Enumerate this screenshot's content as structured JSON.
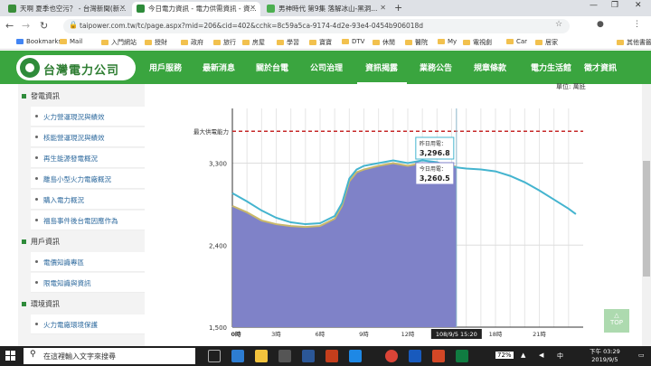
{
  "browser": {
    "tabs": [
      {
        "title": "天啊 夏季也空污？ - 台灣新聞(新..."
      },
      {
        "title": "今日電力資訊 - 電力供需資訊 - 資..."
      },
      {
        "title": "男神時代 第9集 落解冰山-黑洞..."
      }
    ],
    "url": "taipower.com.tw/tc/page.aspx?mid=206&cid=402&cchk=8c59a5ca-9174-4d2e-93e4-0454b906018d",
    "bookmarks": [
      "Bookmarks",
      "Mail",
      "入門網站",
      "授財",
      "政府",
      "旅行",
      "房屋",
      "學習",
      "寶寶",
      "DTV",
      "休閒",
      "醫院",
      "My",
      "電視劇",
      "Car",
      "居家",
      "其他書籤"
    ]
  },
  "site": {
    "logo_text": "台灣電力公司",
    "nav": [
      "用戶服務",
      "最新消息",
      "關於台電",
      "公司治理",
      "資訊揭露",
      "業務公告",
      "規章條款",
      "電力生活館",
      "徵才資訊"
    ],
    "active_nav": "資訊揭露"
  },
  "sidebar": {
    "sections": [
      {
        "title": "發電資訊",
        "items": [
          "火力營運現況與績效",
          "核能營運現況與績效",
          "再生能源發電概況",
          "離島小型火力電廠概況",
          "購入電力概況",
          "福島事件後台電因應作為"
        ]
      },
      {
        "title": "用戶資訊",
        "items": [
          "電價知識專區",
          "限電知識與資訊"
        ]
      },
      {
        "title": "環境資訊",
        "items": [
          "火力電廠環境保護"
        ]
      }
    ]
  },
  "chart_data": {
    "type": "area",
    "unit_label": "單位: 萬瓩",
    "max_line_label": "最大供電能力",
    "max_line_value": 3650,
    "yticks": [
      1500,
      2400,
      3300
    ],
    "ytick_labels": [
      "1,500",
      "2,400",
      "3,300"
    ],
    "ylim": [
      1500,
      3900
    ],
    "xlim": [
      0,
      24
    ],
    "xticks": [
      0,
      3,
      6,
      9,
      12,
      15,
      18,
      21
    ],
    "xtick_labels": [
      "0時",
      "3時",
      "6時",
      "9時",
      "12時",
      "15時",
      "18時",
      "21時"
    ],
    "series": [
      {
        "name": "昨日用電",
        "x": [
          0,
          1,
          2,
          3,
          4,
          5,
          6,
          7,
          7.5,
          8,
          8.5,
          9,
          10,
          11,
          12,
          13,
          14,
          15,
          16,
          17,
          18,
          19,
          20,
          21,
          22,
          23,
          23.5
        ],
        "values": [
          2970,
          2880,
          2780,
          2700,
          2650,
          2630,
          2640,
          2720,
          2860,
          3130,
          3230,
          3270,
          3300,
          3330,
          3300,
          3330,
          3310,
          3260,
          3240,
          3230,
          3210,
          3160,
          3090,
          3000,
          2900,
          2800,
          2740
        ]
      },
      {
        "name": "今日用電",
        "x": [
          0,
          1,
          2,
          3,
          4,
          5,
          6,
          7,
          7.5,
          8,
          8.5,
          9,
          10,
          11,
          12,
          13,
          14,
          15.33
        ],
        "values": [
          2830,
          2760,
          2670,
          2630,
          2610,
          2600,
          2610,
          2690,
          2830,
          3100,
          3200,
          3230,
          3270,
          3300,
          3270,
          3300,
          3290,
          3260
        ]
      }
    ],
    "tooltip": {
      "time": "108/9/5 15:20",
      "yesterday_label": "昨日用電：",
      "yesterday_value": "3,296.8",
      "today_label": "今日用電：",
      "today_value": "3,260.5"
    },
    "colors": {
      "yesterday": "#44b4cf",
      "today_line": "#c9b86a",
      "today_fill": "#7f82c8",
      "max": "#c62828"
    }
  },
  "scroll_top_label": "TOP",
  "taskbar": {
    "search_placeholder": "在這裡輸入文字來搜尋",
    "battery": "72%",
    "time": "下午 03:29",
    "date": "2019/9/5"
  }
}
